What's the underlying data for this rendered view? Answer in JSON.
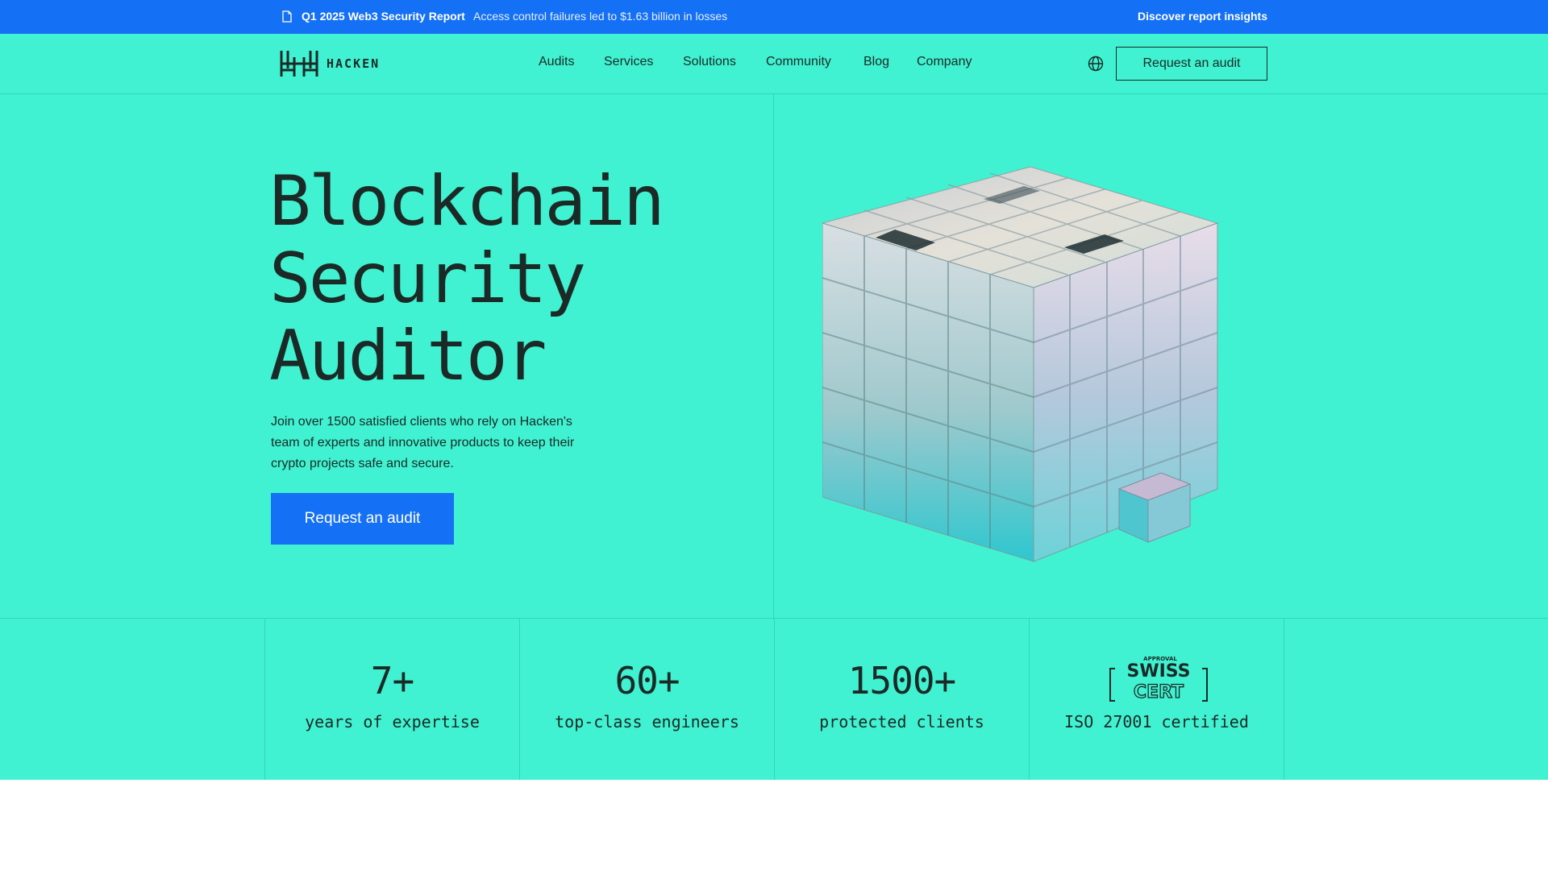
{
  "banner": {
    "report_title": "Q1 2025 Web3 Security Report",
    "report_text": "Access control failures led to $1.63 billion in losses",
    "insights_link": "Discover report insights"
  },
  "header": {
    "logo_text": "HACKEN",
    "nav": [
      "Audits",
      "Services",
      "Solutions",
      "Community",
      "Blog",
      "Company"
    ],
    "cta": "Request an audit"
  },
  "hero": {
    "title_lines": [
      "Blockchain",
      "Security",
      "Auditor"
    ],
    "description": "Join over 1500 satisfied clients who rely on Hacken's team of experts and innovative products to keep their crypto projects safe and secure.",
    "cta": "Request an audit"
  },
  "stats": [
    {
      "value": "7+",
      "label": "years of expertise"
    },
    {
      "value": "60+",
      "label": "top-class engineers"
    },
    {
      "value": "1500+",
      "label": "protected clients"
    },
    {
      "badge_top": "APPROVAL",
      "badge_main": "SWISS",
      "badge_sub": "CERT",
      "label": "ISO 27001 certified"
    }
  ],
  "colors": {
    "banner_blue": "#1470f5",
    "mint": "#40f2d2",
    "text_dark": "#1b2a26"
  },
  "icons": [
    "document-icon",
    "globe-icon"
  ]
}
